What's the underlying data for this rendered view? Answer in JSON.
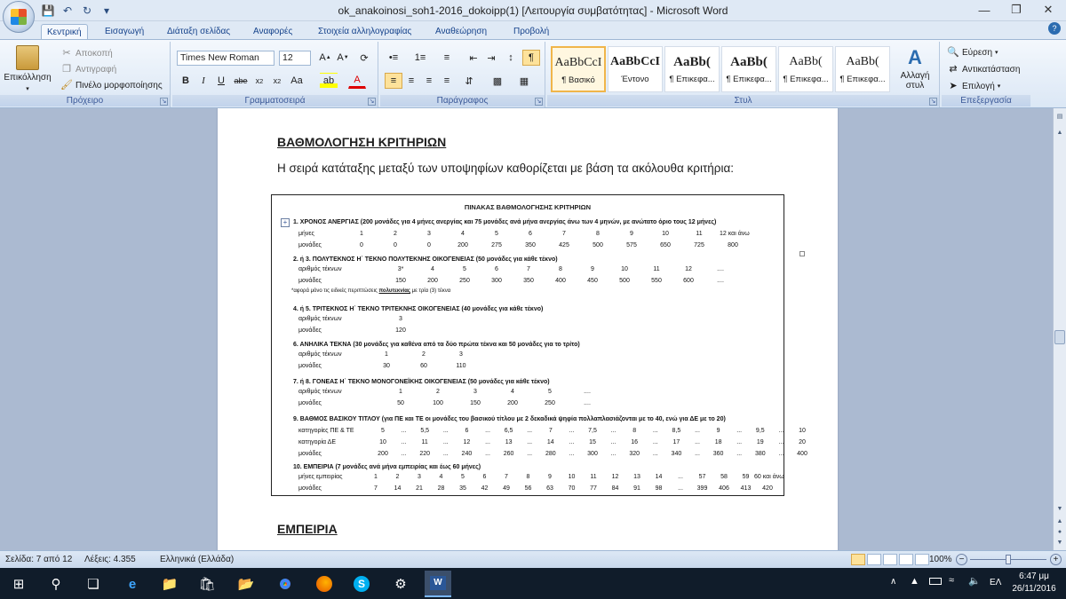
{
  "window": {
    "title": "ok_anakoinosi_soh1-2016_dokoipp(1) [Λειτουργία συμβατότητας] - Microsoft Word",
    "quick_access": [
      "save-icon",
      "undo-icon",
      "redo-icon",
      "customize-icon"
    ],
    "controls": [
      "minimize-icon",
      "restore-icon",
      "close-icon"
    ]
  },
  "tabs": [
    "Κεντρική",
    "Εισαγωγή",
    "Διάταξη σελίδας",
    "Αναφορές",
    "Στοιχεία αλληλογραφίας",
    "Αναθεώρηση",
    "Προβολή"
  ],
  "ribbon": {
    "clipboard": {
      "label": "Πρόχειρο",
      "paste": "Επικόλληση",
      "cut": "Αποκοπή",
      "copy": "Αντιγραφή",
      "format_painter": "Πινέλο μορφοποίησης"
    },
    "font": {
      "label": "Γραμματοσειρά",
      "name": "Times New Roman",
      "size": "12"
    },
    "paragraph": {
      "label": "Παράγραφος"
    },
    "styles": {
      "label": "Στυλ",
      "tiles": [
        {
          "sample": "AaBbCcI",
          "name": "¶ Βασικό"
        },
        {
          "sample": "AaBbCcI",
          "name": "Έντονο"
        },
        {
          "sample": "AaBb(",
          "name": "¶ Επικεφα..."
        },
        {
          "sample": "AaBb(",
          "name": "¶ Επικεφα..."
        },
        {
          "sample": "AaBb(",
          "name": "¶ Επικεφα..."
        },
        {
          "sample": "AaBb(",
          "name": "¶ Επικεφα..."
        }
      ],
      "change": "Αλλαγή στυλ"
    },
    "editing": {
      "label": "Επεξεργασία",
      "find": "Εύρεση",
      "replace": "Αντικατάσταση",
      "select": "Επιλογή"
    }
  },
  "document": {
    "heading1": "ΒΑΘΜΟΛΟΓΗΣΗ ΚΡΙΤΗΡΙΩΝ",
    "intro": "Η σειρά κατάταξης μεταξύ των υποψηφίων καθορίζεται με βάση τα ακόλουθα κριτήρια:",
    "table_title": "ΠΙΝΑΚΑΣ ΒΑΘΜΟΛΟΓΗΣΗΣ ΚΡΙΤΗΡΙΩΝ",
    "c1": {
      "title": "1. ΧΡΟΝΟΣ ΑΝΕΡΓΙΑΣ (200 μονάδες για 4 μήνες ανεργίας και 75 μονάδες ανά μήνα ανεργίας άνω των 4 μηνών, με ανώτατο όριο τους 12 μήνες)",
      "r1_label": "μήνες",
      "r1": [
        "1",
        "2",
        "3",
        "4",
        "5",
        "6",
        "7",
        "8",
        "9",
        "10",
        "11",
        "12 και άνω"
      ],
      "r2_label": "μονάδες",
      "r2": [
        "0",
        "0",
        "0",
        "200",
        "275",
        "350",
        "425",
        "500",
        "575",
        "650",
        "725",
        "800"
      ]
    },
    "c2": {
      "title": "2. ή 3. ΠΟΛΥΤΕΚΝΟΣ Η΄ ΤΕΚΝΟ ΠΟΛΥΤΕΚΝΗΣ ΟΙΚΟΓΕΝΕΙΑΣ (50 μονάδες για κάθε τέκνο)",
      "r1_label": "αριθμός τέκνων",
      "r1": [
        "3*",
        "4",
        "5",
        "6",
        "7",
        "8",
        "9",
        "10",
        "11",
        "12",
        "...."
      ],
      "r2_label": "μονάδες",
      "r2": [
        "150",
        "200",
        "250",
        "300",
        "350",
        "400",
        "450",
        "500",
        "550",
        "600",
        "...."
      ],
      "note_a": "*αφορά μόνο τις ειδικές περιπτώσεις ",
      "note_b": "πολυτεκνίας",
      " note_c": " με τρία (3) τέκνα"
    },
    "c3": {
      "title": "4. ή 5. ΤΡΙΤΕΚΝΟΣ Η΄ ΤΕΚΝΟ ΤΡΙΤΕΚΝΗΣ ΟΙΚΟΓΕΝΕΙΑΣ (40 μονάδες για κάθε τέκνο)",
      "r1_label": "αριθμός τέκνων",
      "r1": [
        "3"
      ],
      "r2_label": "μονάδες",
      "r2": [
        "120"
      ]
    },
    "c4": {
      "title": "6. ΑΝΗΛΙΚΑ ΤΕΚΝΑ (30 μονάδες για καθένα από τα δύο πρώτα τέκνα και 50 μονάδες για το τρίτο)",
      "r1_label": "αριθμός τέκνων",
      "r1": [
        "1",
        "2",
        "3"
      ],
      "r2_label": "μονάδες",
      "r2": [
        "30",
        "60",
        "110"
      ]
    },
    "c5": {
      "title": "7. ή 8. ΓΟΝΕΑΣ Η΄ ΤΕΚΝΟ ΜΟΝΟΓΟΝΕΪΚΗΣ ΟΙΚΟΓΕΝΕΙΑΣ (50 μονάδες για κάθε τέκνο)",
      "r1_label": "αριθμός τέκνων",
      "r1": [
        "1",
        "2",
        "3",
        "4",
        "5",
        "...."
      ],
      "r2_label": "μονάδες",
      "r2": [
        "50",
        "100",
        "150",
        "200",
        "250",
        "...."
      ]
    },
    "c6": {
      "title": "9. ΒΑΘΜΟΣ ΒΑΣΙΚΟΥ ΤΙΤΛΟΥ (για ΠΕ και ΤΕ οι μονάδες του βασικού τίτλου με 2 δεκαδικά ψηφία πολλαπλασιάζονται με το 40, ενώ για ΔΕ με το 20)",
      "r1_label": "κατηγορίες ΠΕ & ΤΕ",
      "r1": [
        "5",
        "...",
        "5,5",
        "...",
        "6",
        "...",
        "6,5",
        "...",
        "7",
        "...",
        "7,5",
        "...",
        "8",
        "...",
        "8,5",
        "...",
        "9",
        "...",
        "9,5",
        "...",
        "10"
      ],
      "r2_label": "κατηγορία ΔΕ",
      "r2": [
        "10",
        "...",
        "11",
        "...",
        "12",
        "...",
        "13",
        "...",
        "14",
        "...",
        "15",
        "...",
        "16",
        "...",
        "17",
        "...",
        "18",
        "...",
        "19",
        "...",
        "20"
      ],
      "r3_label": "μονάδες",
      "r3": [
        "200",
        "...",
        "220",
        "...",
        "240",
        "...",
        "260",
        "...",
        "280",
        "...",
        "300",
        "...",
        "320",
        "...",
        "340",
        "...",
        "360",
        "...",
        "380",
        "...",
        "400"
      ]
    },
    "c7": {
      "title": "10. ΕΜΠΕΙΡΙΑ (7 μονάδες ανά μήνα εμπειρίας και έως 60 μήνες)",
      "r1_label": "μήνες εμπειρίας",
      "r1": [
        "1",
        "2",
        "3",
        "4",
        "5",
        "6",
        "7",
        "8",
        "9",
        "10",
        "11",
        "12",
        "13",
        "14",
        "...",
        "57",
        "58",
        "59",
        "60 και άνω"
      ],
      "r2_label": "μονάδες",
      "r2": [
        "7",
        "14",
        "21",
        "28",
        "35",
        "42",
        "49",
        "56",
        "63",
        "70",
        "77",
        "84",
        "91",
        "98",
        "...",
        "399",
        "406",
        "413",
        "420"
      ]
    },
    "heading2": "ΕΜΠΕΙΡΙΑ"
  },
  "status": {
    "page": "Σελίδα: 7 από 12",
    "words": "Λέξεις: 4.355",
    "language": "Ελληνικά (Ελλάδα)",
    "zoom": "100%"
  },
  "taskbar": {
    "lang": "ΕΛ",
    "time": "6:47 μμ",
    "date": "26/11/2016"
  }
}
